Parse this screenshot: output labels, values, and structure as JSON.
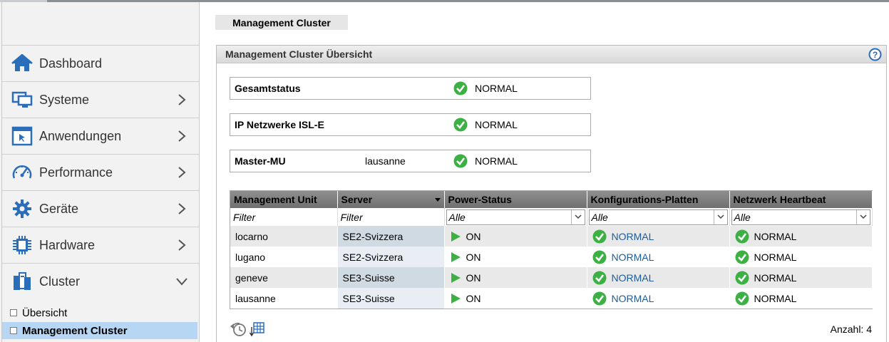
{
  "sidebar": {
    "items": [
      {
        "label": "Dashboard",
        "icon": "home-icon"
      },
      {
        "label": "Systeme",
        "icon": "monitor-icon"
      },
      {
        "label": "Anwendungen",
        "icon": "application-window-icon"
      },
      {
        "label": "Performance",
        "icon": "gauge-icon"
      },
      {
        "label": "Geräte",
        "icon": "gear-icon"
      },
      {
        "label": "Hardware",
        "icon": "chip-icon"
      },
      {
        "label": "Cluster",
        "icon": "cluster-icon"
      }
    ],
    "subitems": [
      {
        "label": "Übersicht"
      },
      {
        "label": "Management Cluster"
      }
    ]
  },
  "page": {
    "tab_title": "Management Cluster",
    "panel_title": "Management Cluster Übersicht"
  },
  "status": [
    {
      "label": "Gesamtstatus",
      "value": "",
      "state": "NORMAL"
    },
    {
      "label": "IP Netzwerke ISL-E",
      "value": "",
      "state": "NORMAL"
    },
    {
      "label": "Master-MU",
      "value": "lausanne",
      "state": "NORMAL"
    }
  ],
  "table": {
    "headers": [
      "Management Unit",
      "Server",
      "Power-Status",
      "Konfigurations-Platten",
      "Netzwerk Heartbeat"
    ],
    "filters": {
      "unit_placeholder": "Filter",
      "server_placeholder": "Filter",
      "power": "Alle",
      "config": "Alle",
      "heartbeat": "Alle"
    },
    "rows": [
      {
        "unit": "locarno",
        "server": "SE2-Svizzera",
        "power": "ON",
        "config": "NORMAL",
        "heartbeat": "NORMAL"
      },
      {
        "unit": "lugano",
        "server": "SE2-Svizzera",
        "power": "ON",
        "config": "NORMAL",
        "heartbeat": "NORMAL"
      },
      {
        "unit": "geneve",
        "server": "SE3-Suisse",
        "power": "ON",
        "config": "NORMAL",
        "heartbeat": "NORMAL"
      },
      {
        "unit": "lausanne",
        "server": "SE3-Suisse",
        "power": "ON",
        "config": "NORMAL",
        "heartbeat": "NORMAL"
      }
    ]
  },
  "footer": {
    "count": "Anzahl: 4"
  },
  "colors": {
    "ok_green": "#3cb043",
    "link_blue": "#1e5c9b",
    "accent_blue": "#2a6ebb",
    "selection": "#b7d6f4"
  }
}
